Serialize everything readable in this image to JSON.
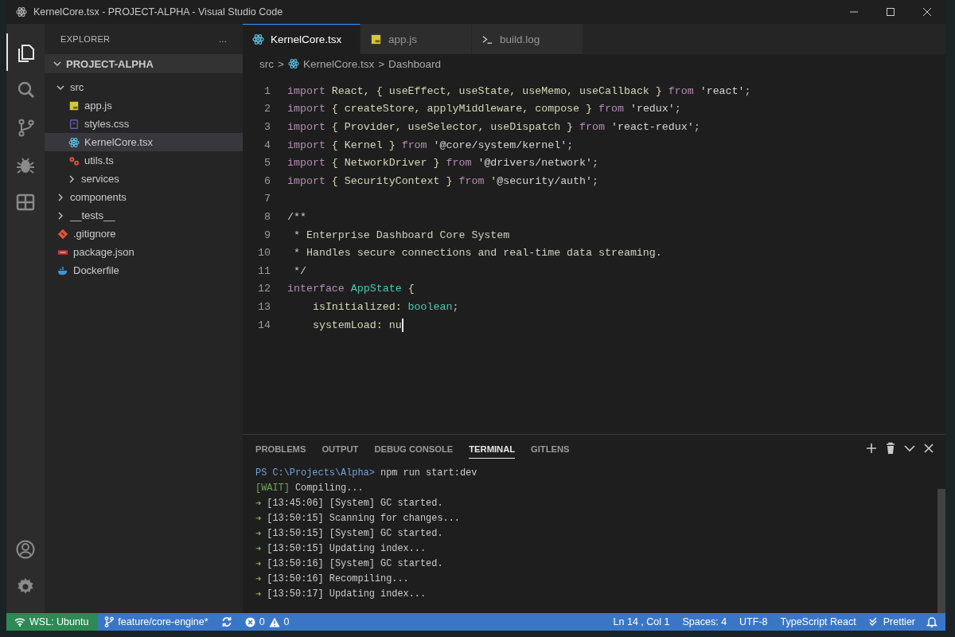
{
  "window": {
    "title": "KernelCore.tsx - PROJECT-ALPHA - Visual Studio Code"
  },
  "activity_bar": [
    {
      "kind": "files",
      "selected": true
    },
    {
      "kind": "search",
      "selected": false
    },
    {
      "kind": "source-control",
      "selected": false
    },
    {
      "kind": "debug",
      "selected": false
    },
    {
      "kind": "extensions",
      "selected": false
    },
    {
      "kind": "account",
      "selected": false
    },
    {
      "kind": "settings",
      "selected": false
    }
  ],
  "explorer": {
    "title": "EXPLORER",
    "more": "...",
    "project": "PROJECT-ALPHA",
    "tree": [
      {
        "kind": "folder",
        "label": "src",
        "expanded": true,
        "selected": false,
        "children": [
          {
            "kind": "js",
            "label": "app.js",
            "selected": false
          },
          {
            "kind": "css",
            "label": "styles.css",
            "selected": false
          },
          {
            "kind": "react",
            "label": "KernelCore.tsx",
            "selected": true
          },
          {
            "kind": "gear",
            "label": "utils.ts",
            "selected": false
          },
          {
            "kind": "folder",
            "label": "services",
            "expanded": false,
            "selected": false
          }
        ]
      },
      {
        "kind": "folder",
        "label": "components",
        "expanded": false,
        "selected": false
      },
      {
        "kind": "folder",
        "label": "__tests__",
        "expanded": false,
        "selected": false
      },
      {
        "kind": "git",
        "label": ".gitignore",
        "selected": false
      },
      {
        "kind": "npm",
        "label": "package.json",
        "selected": false
      },
      {
        "kind": "docker",
        "label": "Dockerfile",
        "selected": false
      }
    ]
  },
  "tabs": [
    {
      "label": "KernelCore.tsx",
      "kind": "react",
      "selected": true
    },
    {
      "label": "app.js",
      "kind": "js",
      "selected": false
    },
    {
      "label": "build.log",
      "kind": "terminal",
      "selected": false
    }
  ],
  "breadcrumb": [
    {
      "kind": "crumb",
      "text": "src"
    },
    {
      "kind": "separator",
      "text": ">"
    },
    {
      "kind": "react",
      "text": "KernelCore.tsx"
    },
    {
      "kind": "separator",
      "text": ">"
    },
    {
      "kind": "crumb",
      "text": "Dashboard"
    }
  ],
  "code": [
    {
      "number": "1",
      "cursor": false,
      "tokens": [
        {
          "kind": "keyword",
          "text": "import"
        },
        {
          "kind": "ident",
          "text": " React, { useEffect, useState, useMemo, useCallback } "
        },
        {
          "kind": "keyword",
          "text": "from"
        },
        {
          "kind": "string",
          "text": " 'react'"
        },
        {
          "kind": "punct",
          "text": ";"
        }
      ]
    },
    {
      "number": "2",
      "cursor": false,
      "tokens": [
        {
          "kind": "keyword",
          "text": "import"
        },
        {
          "kind": "ident",
          "text": " { createStore, applyMiddleware, compose } "
        },
        {
          "kind": "keyword",
          "text": "from"
        },
        {
          "kind": "string",
          "text": " 'redux'"
        },
        {
          "kind": "punct",
          "text": ";"
        }
      ]
    },
    {
      "number": "3",
      "cursor": false,
      "tokens": [
        {
          "kind": "keyword",
          "text": "import"
        },
        {
          "kind": "ident",
          "text": " { Provider, useSelector, useDispatch } "
        },
        {
          "kind": "keyword",
          "text": "from"
        },
        {
          "kind": "string",
          "text": " 'react-redux'"
        },
        {
          "kind": "punct",
          "text": ";"
        }
      ]
    },
    {
      "number": "4",
      "cursor": false,
      "tokens": [
        {
          "kind": "keyword",
          "text": "import"
        },
        {
          "kind": "ident",
          "text": " { Kernel } "
        },
        {
          "kind": "keyword",
          "text": "from"
        },
        {
          "kind": "string",
          "text": " '@core/system/kernel'"
        },
        {
          "kind": "punct",
          "text": ";"
        }
      ]
    },
    {
      "number": "5",
      "cursor": false,
      "tokens": [
        {
          "kind": "keyword",
          "text": "import"
        },
        {
          "kind": "ident",
          "text": " { NetworkDriver } "
        },
        {
          "kind": "keyword",
          "text": "from"
        },
        {
          "kind": "string",
          "text": " '@drivers/network'"
        },
        {
          "kind": "punct",
          "text": ";"
        }
      ]
    },
    {
      "number": "6",
      "cursor": false,
      "tokens": [
        {
          "kind": "keyword",
          "text": "import"
        },
        {
          "kind": "ident",
          "text": " { SecurityContext } "
        },
        {
          "kind": "keyword",
          "text": "from"
        },
        {
          "kind": "string",
          "text": " '@security/auth'"
        },
        {
          "kind": "punct",
          "text": ";"
        }
      ]
    },
    {
      "number": "7",
      "cursor": false
    },
    {
      "number": "8",
      "cursor": false,
      "tokens": [
        {
          "kind": "comment",
          "text": "/**"
        }
      ]
    },
    {
      "number": "9",
      "cursor": false,
      "tokens": [
        {
          "kind": "comment",
          "text": " * Enterprise Dashboard Core System"
        }
      ]
    },
    {
      "number": "10",
      "cursor": false,
      "tokens": [
        {
          "kind": "comment",
          "text": " * Handles secure connections and real-time data streaming."
        }
      ]
    },
    {
      "number": "11",
      "cursor": false,
      "tokens": [
        {
          "kind": "comment",
          "text": " */"
        }
      ]
    },
    {
      "number": "12",
      "cursor": false,
      "tokens": [
        {
          "kind": "keyword",
          "text": "interface"
        },
        {
          "kind": "type",
          "text": " AppState"
        },
        {
          "kind": "ident",
          "text": " {"
        }
      ]
    },
    {
      "number": "13",
      "cursor": false,
      "tokens": [
        {
          "kind": "ident",
          "text": "    isInitialized: "
        },
        {
          "kind": "type",
          "text": "boolean"
        },
        {
          "kind": "punct",
          "text": ";"
        }
      ]
    },
    {
      "number": "14",
      "cursor": true,
      "tokens": [
        {
          "kind": "ident",
          "text": "    systemLoad: nu"
        }
      ]
    }
  ],
  "panel": {
    "tabs": [
      {
        "label": "PROBLEMS",
        "selected": false
      },
      {
        "label": "OUTPUT",
        "selected": false
      },
      {
        "label": "DEBUG CONSOLE",
        "selected": false
      },
      {
        "label": "TERMINAL",
        "selected": true
      },
      {
        "label": "GITLENS",
        "selected": false
      }
    ],
    "terminal": [
      {
        "kind": "prompt",
        "prompt": "PS C:\\Projects\\Alpha>",
        "command": " npm run start:dev"
      },
      {
        "kind": "status",
        "tag": "[WAIT]",
        "text": " Compiling..."
      },
      {
        "kind": "log",
        "arrow": "➜",
        "text": "[13:45:06] [System] GC started."
      },
      {
        "kind": "log",
        "arrow": "➜",
        "text": "[13:50:15] Scanning for changes..."
      },
      {
        "kind": "log",
        "arrow": "➜",
        "text": "[13:50:15] [System] GC started."
      },
      {
        "kind": "log",
        "arrow": "➜",
        "text": "[13:50:15] Updating index..."
      },
      {
        "kind": "log",
        "arrow": "➜",
        "text": "[13:50:16] [System] GC started."
      },
      {
        "kind": "log",
        "arrow": "➜",
        "text": "[13:50:16] Recompiling..."
      },
      {
        "kind": "log",
        "arrow": "➜",
        "text": "[13:50:17] Updating index..."
      }
    ]
  },
  "status_bar": {
    "left": [
      {
        "kind": "remote",
        "text": "WSL: Ubuntu"
      },
      {
        "kind": "branch",
        "text": "feature/core-engine*"
      },
      {
        "kind": "sync"
      },
      {
        "kind": "problems",
        "errors": "0",
        "warnings": "0"
      }
    ],
    "right": [
      {
        "kind": "text",
        "text": "Ln 14 , Col 1"
      },
      {
        "kind": "text",
        "text": "Spaces: 4"
      },
      {
        "kind": "text",
        "text": "UTF-8"
      },
      {
        "kind": "text",
        "text": "TypeScript React"
      },
      {
        "kind": "prettier",
        "text": "Prettier"
      },
      {
        "kind": "bell"
      }
    ]
  }
}
